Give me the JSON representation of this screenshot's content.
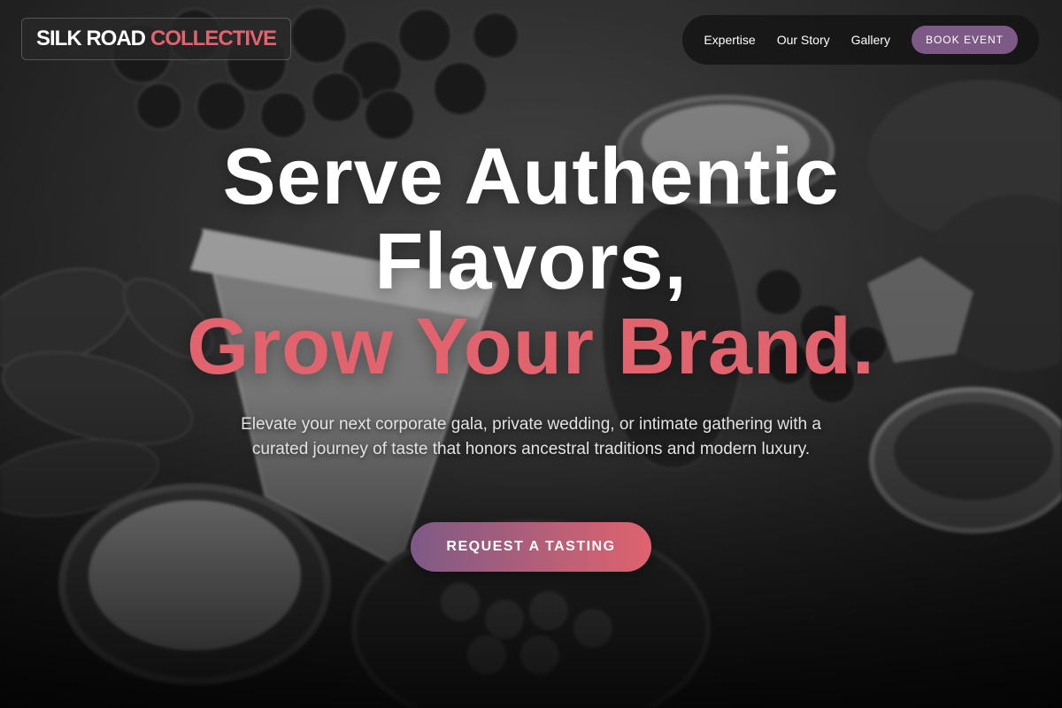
{
  "header": {
    "brand_primary": "SILK ROAD",
    "brand_accent": "COLLECTIVE",
    "nav_items": [
      {
        "label": "Expertise"
      },
      {
        "label": "Our Story"
      },
      {
        "label": "Gallery"
      }
    ],
    "book_label": "BOOK EVENT"
  },
  "hero": {
    "headline_line1": "Serve Authentic",
    "headline_line2": "Flavors,",
    "headline_accent": "Grow Your Brand.",
    "subtext": "Elevate your next corporate gala, private wedding, or intimate gathering with a curated journey of taste that honors ancestral traditions and modern luxury.",
    "cta_label": "REQUEST A TASTING"
  },
  "colors": {
    "accent": "#e0636e",
    "secondary": "#7d5a86",
    "text": "#ffffff"
  },
  "background": {
    "icon": "food-platter-photo"
  }
}
